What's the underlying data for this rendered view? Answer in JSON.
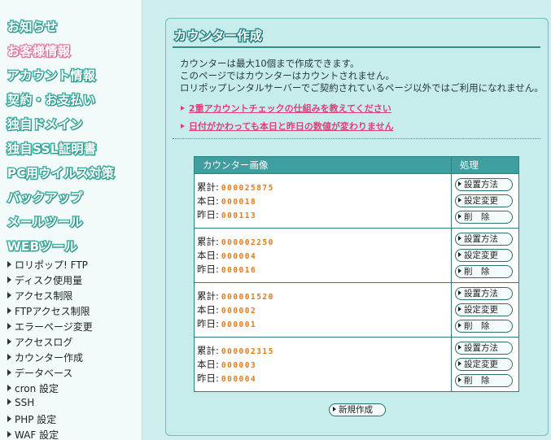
{
  "sidebar": {
    "main_items": [
      {
        "label": "お知らせ"
      },
      {
        "label": "お客様情報"
      },
      {
        "label": "アカウント情報"
      },
      {
        "label": "契約・お支払い"
      },
      {
        "label": "独自ドメイン"
      },
      {
        "label": "独自SSL証明書"
      },
      {
        "label": "PC用ウイルス対策"
      },
      {
        "label": "バックアップ"
      },
      {
        "label": "メールツール"
      },
      {
        "label": "WEBツール"
      }
    ],
    "web_tools": [
      {
        "label": "ロリポップ! FTP"
      },
      {
        "label": "ディスク使用量"
      },
      {
        "label": "アクセス制限"
      },
      {
        "label": "FTPアクセス制限"
      },
      {
        "label": "エラーページ変更"
      },
      {
        "label": "アクセスログ"
      },
      {
        "label": "カウンター作成"
      },
      {
        "label": "データベース"
      },
      {
        "label": "cron 設定"
      },
      {
        "label": "SSH"
      },
      {
        "label": "PHP 設定"
      },
      {
        "label": "WAF 設定"
      }
    ]
  },
  "main": {
    "title": "カウンター作成",
    "intro": [
      "カウンターは最大10個まで作成できます。",
      "このページではカウンターはカウントされません。",
      "ロリポップレンタルサーバーでご契約されているページ以外ではご利用になれません。"
    ],
    "links": [
      "2重アカウントチェックの仕組みを教えてください",
      "日付がかわっても本日と昨日の数値が変わりません"
    ],
    "table": {
      "headers": {
        "image": "カウンター画像",
        "action": "処理"
      },
      "labels": {
        "total": "累計:",
        "today": "本日:",
        "yesterday": "昨日:"
      },
      "buttons": {
        "setup": "設置方法",
        "settings": "設定変更",
        "delete": "削　除"
      },
      "rows": [
        {
          "total": "000025875",
          "today": "000018",
          "yesterday": "000113"
        },
        {
          "total": "000002250",
          "today": "000004",
          "yesterday": "000016"
        },
        {
          "total": "000001520",
          "today": "000002",
          "yesterday": "000001"
        },
        {
          "total": "000002315",
          "today": "000003",
          "yesterday": "000004"
        }
      ]
    },
    "new_button": "新規作成"
  }
}
